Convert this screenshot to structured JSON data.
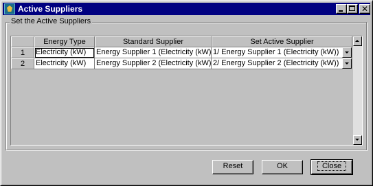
{
  "window": {
    "title": "Active Suppliers"
  },
  "group": {
    "label": "Set the Active Suppliers"
  },
  "table": {
    "columns": [
      "Energy Type",
      "Standard Supplier",
      "Set Active Supplier"
    ],
    "rows": [
      {
        "num": "1",
        "energy": "Electricity (kW)",
        "standard": "Energy Supplier 1 (Electricity (kW))",
        "active": "1/ Energy Supplier 1 (Electricity (kW))"
      },
      {
        "num": "2",
        "energy": "Electricity (kW)",
        "standard": "Energy Supplier 2 (Electricity (kW))",
        "active": "2/ Energy Supplier 2 (Electricity (kW))"
      }
    ]
  },
  "buttons": {
    "reset": "Reset",
    "ok": "OK",
    "close": "Close"
  },
  "icons": {
    "app": "app-icon",
    "minimize": "minimize-icon",
    "maximize": "maximize-icon",
    "close": "close-icon",
    "dropdown": "chevron-down-icon"
  }
}
